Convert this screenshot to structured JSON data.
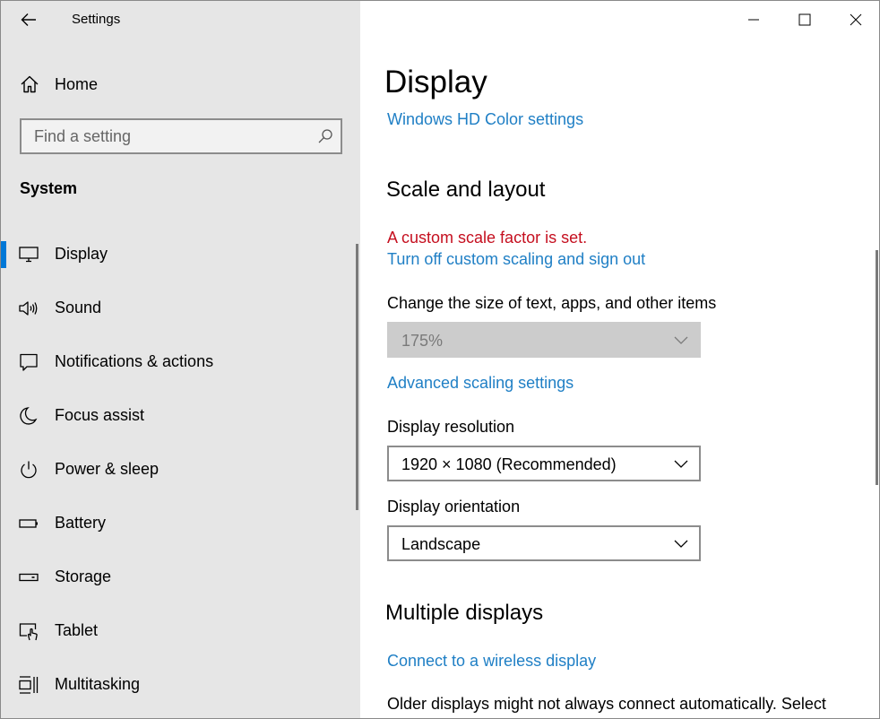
{
  "app": {
    "title": "Settings"
  },
  "sidebar": {
    "home_label": "Home",
    "search_placeholder": "Find a setting",
    "section_label": "System",
    "items": [
      {
        "label": "Display",
        "icon": "monitor-icon",
        "selected": true
      },
      {
        "label": "Sound",
        "icon": "speaker-icon"
      },
      {
        "label": "Notifications & actions",
        "icon": "notification-icon"
      },
      {
        "label": "Focus assist",
        "icon": "moon-icon"
      },
      {
        "label": "Power & sleep",
        "icon": "power-icon"
      },
      {
        "label": "Battery",
        "icon": "battery-icon"
      },
      {
        "label": "Storage",
        "icon": "storage-icon"
      },
      {
        "label": "Tablet",
        "icon": "tablet-icon"
      },
      {
        "label": "Multitasking",
        "icon": "multitasking-icon"
      }
    ]
  },
  "main": {
    "title": "Display",
    "hd_color_link": "Windows HD Color settings",
    "scale_heading": "Scale and layout",
    "custom_scale_warning": "A custom scale factor is set.",
    "turn_off_scaling_link": "Turn off custom scaling and sign out",
    "change_size_label": "Change the size of text, apps, and other items",
    "scale_value": "175%",
    "advanced_scaling_link": "Advanced scaling settings",
    "resolution_label": "Display resolution",
    "resolution_value": "1920 × 1080 (Recommended)",
    "orientation_label": "Display orientation",
    "orientation_value": "Landscape",
    "multiple_heading": "Multiple displays",
    "wireless_link": "Connect to a wireless display",
    "older_displays_text": "Older displays might not always connect automatically. Select"
  },
  "colors": {
    "accent": "#0078d7",
    "link": "#1f7fc5",
    "warning": "#c50f1f",
    "sidebar_bg": "#e6e6e6"
  }
}
